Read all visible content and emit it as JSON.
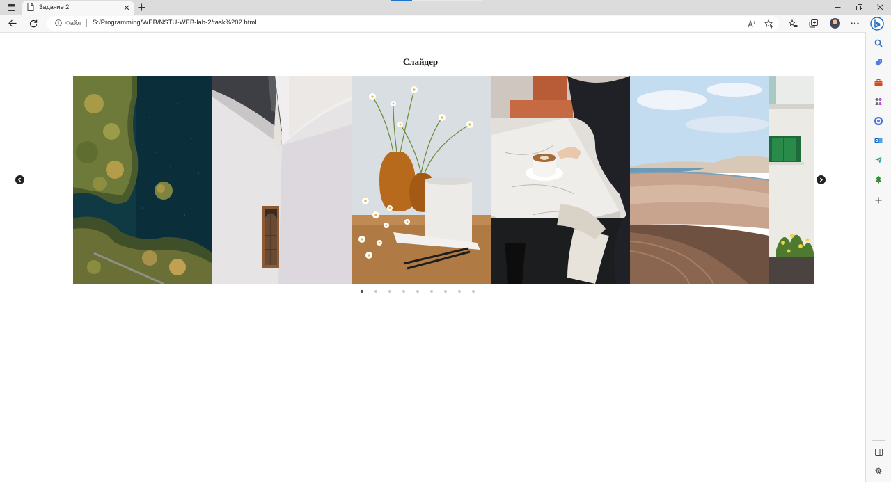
{
  "browser": {
    "tab": {
      "title": "Задание 2"
    },
    "address_bar": {
      "site_label": "Файл",
      "url": "S:/Programming/WEB/NSTU-WEB-lab-2/task%202.html"
    }
  },
  "page": {
    "title": "Слайдер"
  },
  "slider": {
    "slides": [
      {
        "name": "aerial-lake-forest"
      },
      {
        "name": "white-wall-window"
      },
      {
        "name": "chamomile-vases-candle"
      },
      {
        "name": "coffee-marble-table"
      },
      {
        "name": "desert-dunes-lagoon"
      },
      {
        "name": "white-house-green-window"
      }
    ],
    "dot_count": 9,
    "active_index": 0
  },
  "icons": {
    "prev": "chevron-left-icon",
    "next": "chevron-right-icon"
  },
  "colors": {
    "edge_accent": "#1f73c9",
    "arrow_bg": "#222222",
    "dot_active": "#4a4a4a",
    "dot_inactive": "#c9c9c9"
  }
}
